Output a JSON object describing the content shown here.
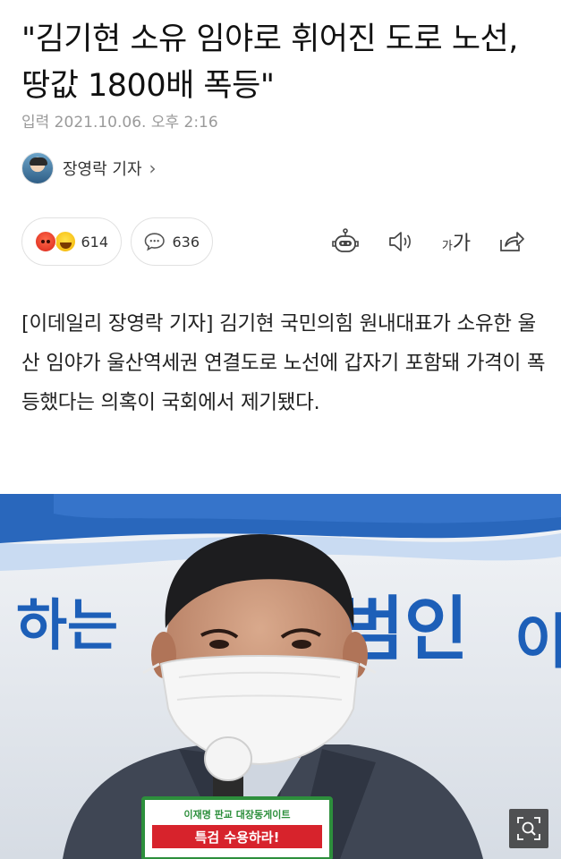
{
  "article": {
    "headline": "\"김기현 소유 임야로 휘어진 도로 노선, 땅값 1800배 폭등\"",
    "date": "입력 2021.10.06. 오후 2:16",
    "reporter": "장영락 기자",
    "reporter_chevron": "›",
    "lead": "[이데일리 장영락 기자] 김기현 국민의힘 원내대표가 소유한 울산 임야가 울산역세권 연결도로 노선에 갑자기 포함돼 가격이 폭등했다는 의혹이 국회에서 제기됐다."
  },
  "reactions": {
    "count": "614",
    "emotions": [
      "angry-face-icon",
      "laughing-face-icon"
    ]
  },
  "comments": {
    "count": "636",
    "icon": "comment-bubble-icon"
  },
  "toolbar": {
    "font_size_small": "가",
    "font_size_large": "가",
    "icons": [
      "robot-summary-icon",
      "speaker-icon",
      "font-size-icon",
      "share-icon"
    ]
  },
  "photo": {
    "banner_text_1": "하는",
    "banner_text_2": "범인",
    "banner_text_3": "이",
    "sign_line_1": "이재명 판교 대장동게이트",
    "sign_line_2": "특검 수용하라!"
  },
  "colors": {
    "banner_blue": "#1d5fb8",
    "sign_red": "#d7232c",
    "sign_green": "#2d8f3c"
  }
}
